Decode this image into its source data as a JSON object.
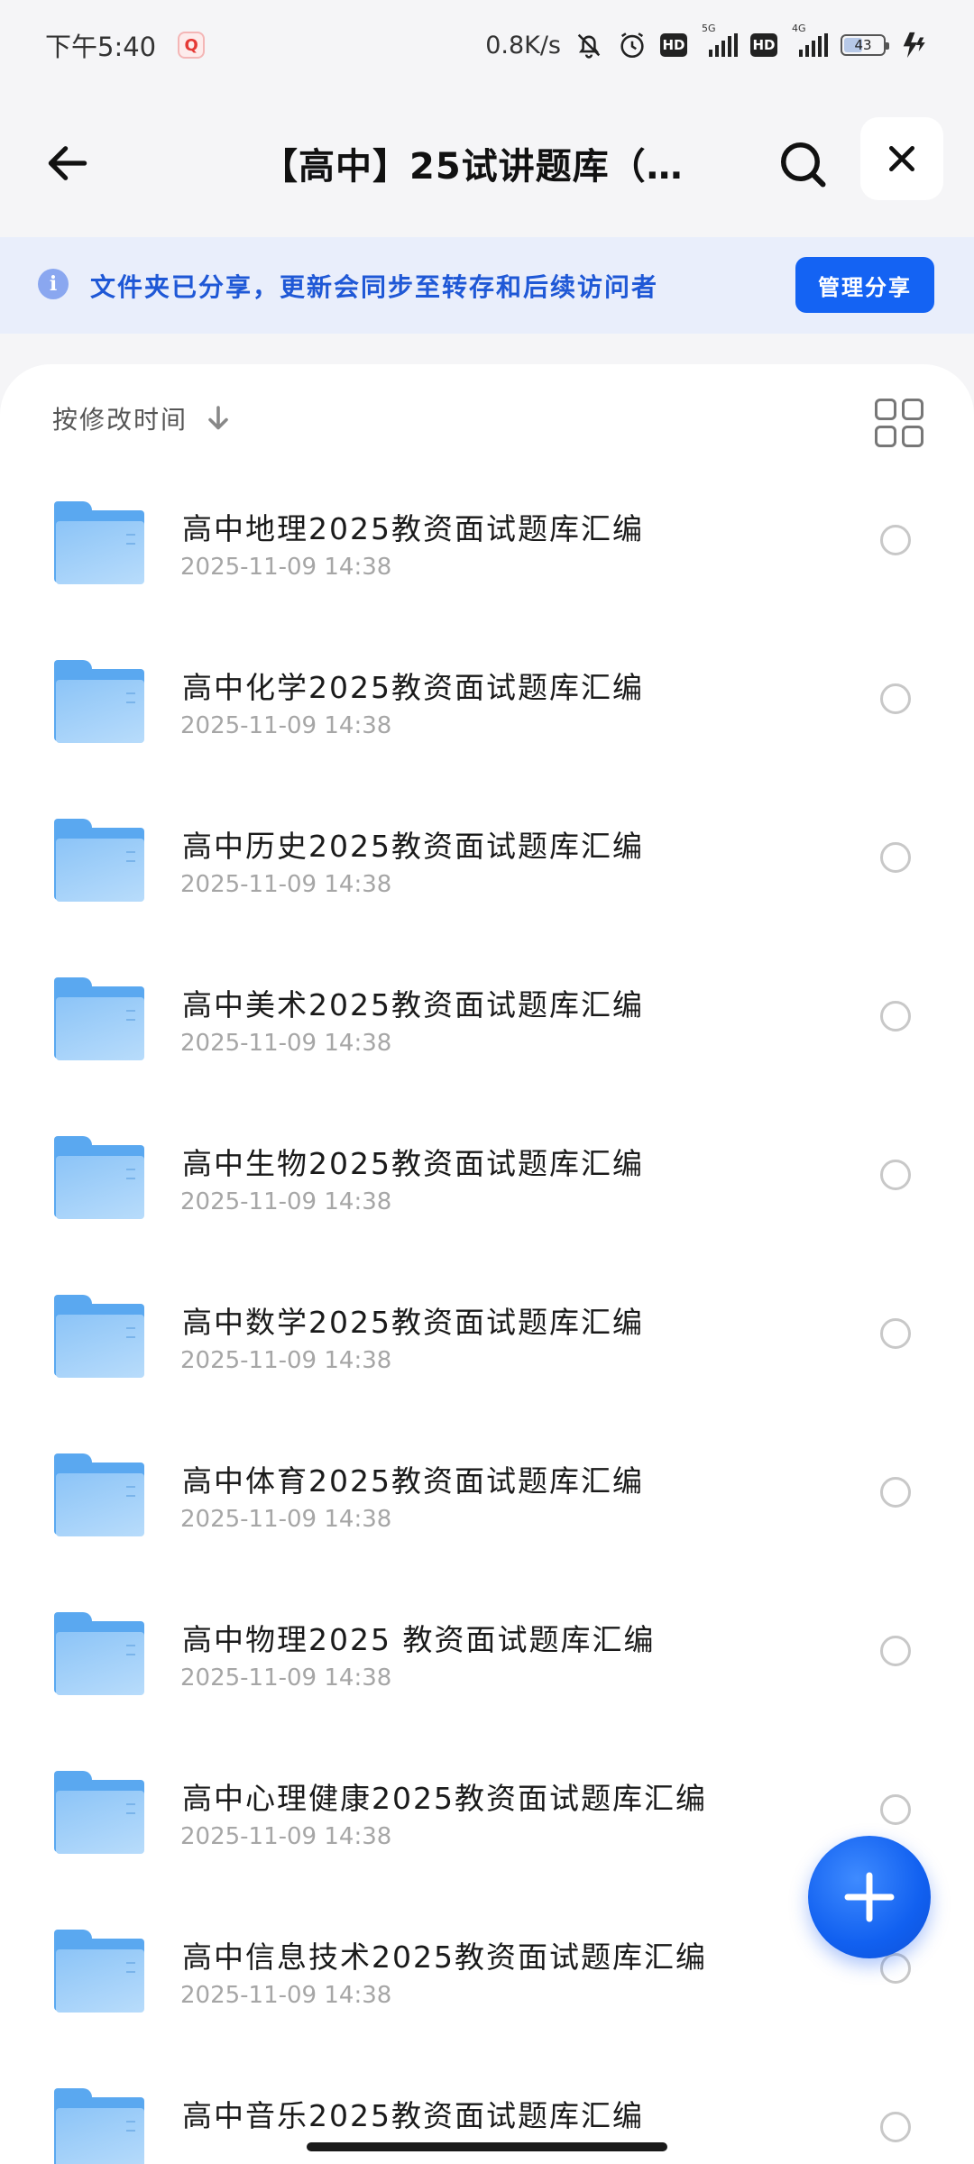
{
  "status_bar": {
    "time": "下午5:40",
    "net_speed": "0.8K/s",
    "hd1": "HD",
    "hd2": "HD",
    "sim1_type": "5G",
    "sim2_type": "4G",
    "battery": "43"
  },
  "header": {
    "title": "【高中】25试讲题库（…"
  },
  "banner": {
    "info_icon": "i",
    "text": "文件夹已分享，更新会同步至转存和后续访问者",
    "manage_button": "管理分享"
  },
  "sort": {
    "label": "按修改时间"
  },
  "files": [
    {
      "name": "高中地理2025教资面试题库汇编",
      "date": "2025-11-09  14:38"
    },
    {
      "name": "高中化学2025教资面试题库汇编",
      "date": "2025-11-09  14:38"
    },
    {
      "name": "高中历史2025教资面试题库汇编",
      "date": "2025-11-09  14:38"
    },
    {
      "name": "高中美术2025教资面试题库汇编",
      "date": "2025-11-09  14:38"
    },
    {
      "name": "高中生物2025教资面试题库汇编",
      "date": "2025-11-09  14:38"
    },
    {
      "name": "高中数学2025教资面试题库汇编",
      "date": "2025-11-09  14:38"
    },
    {
      "name": "高中体育2025教资面试题库汇编",
      "date": "2025-11-09  14:38"
    },
    {
      "name": "高中物理2025 教资面试题库汇编",
      "date": "2025-11-09  14:38"
    },
    {
      "name": "高中心理健康2025教资面试题库汇编",
      "date": "2025-11-09  14:38"
    },
    {
      "name": "高中信息技术2025教资面试题库汇编",
      "date": "2025-11-09  14:38"
    },
    {
      "name": "高中音乐2025教资面试题库汇编",
      "date": ""
    }
  ],
  "colors": {
    "accent": "#1463f3",
    "banner_bg": "#e9eefb",
    "folder": "#5aa8f0"
  }
}
